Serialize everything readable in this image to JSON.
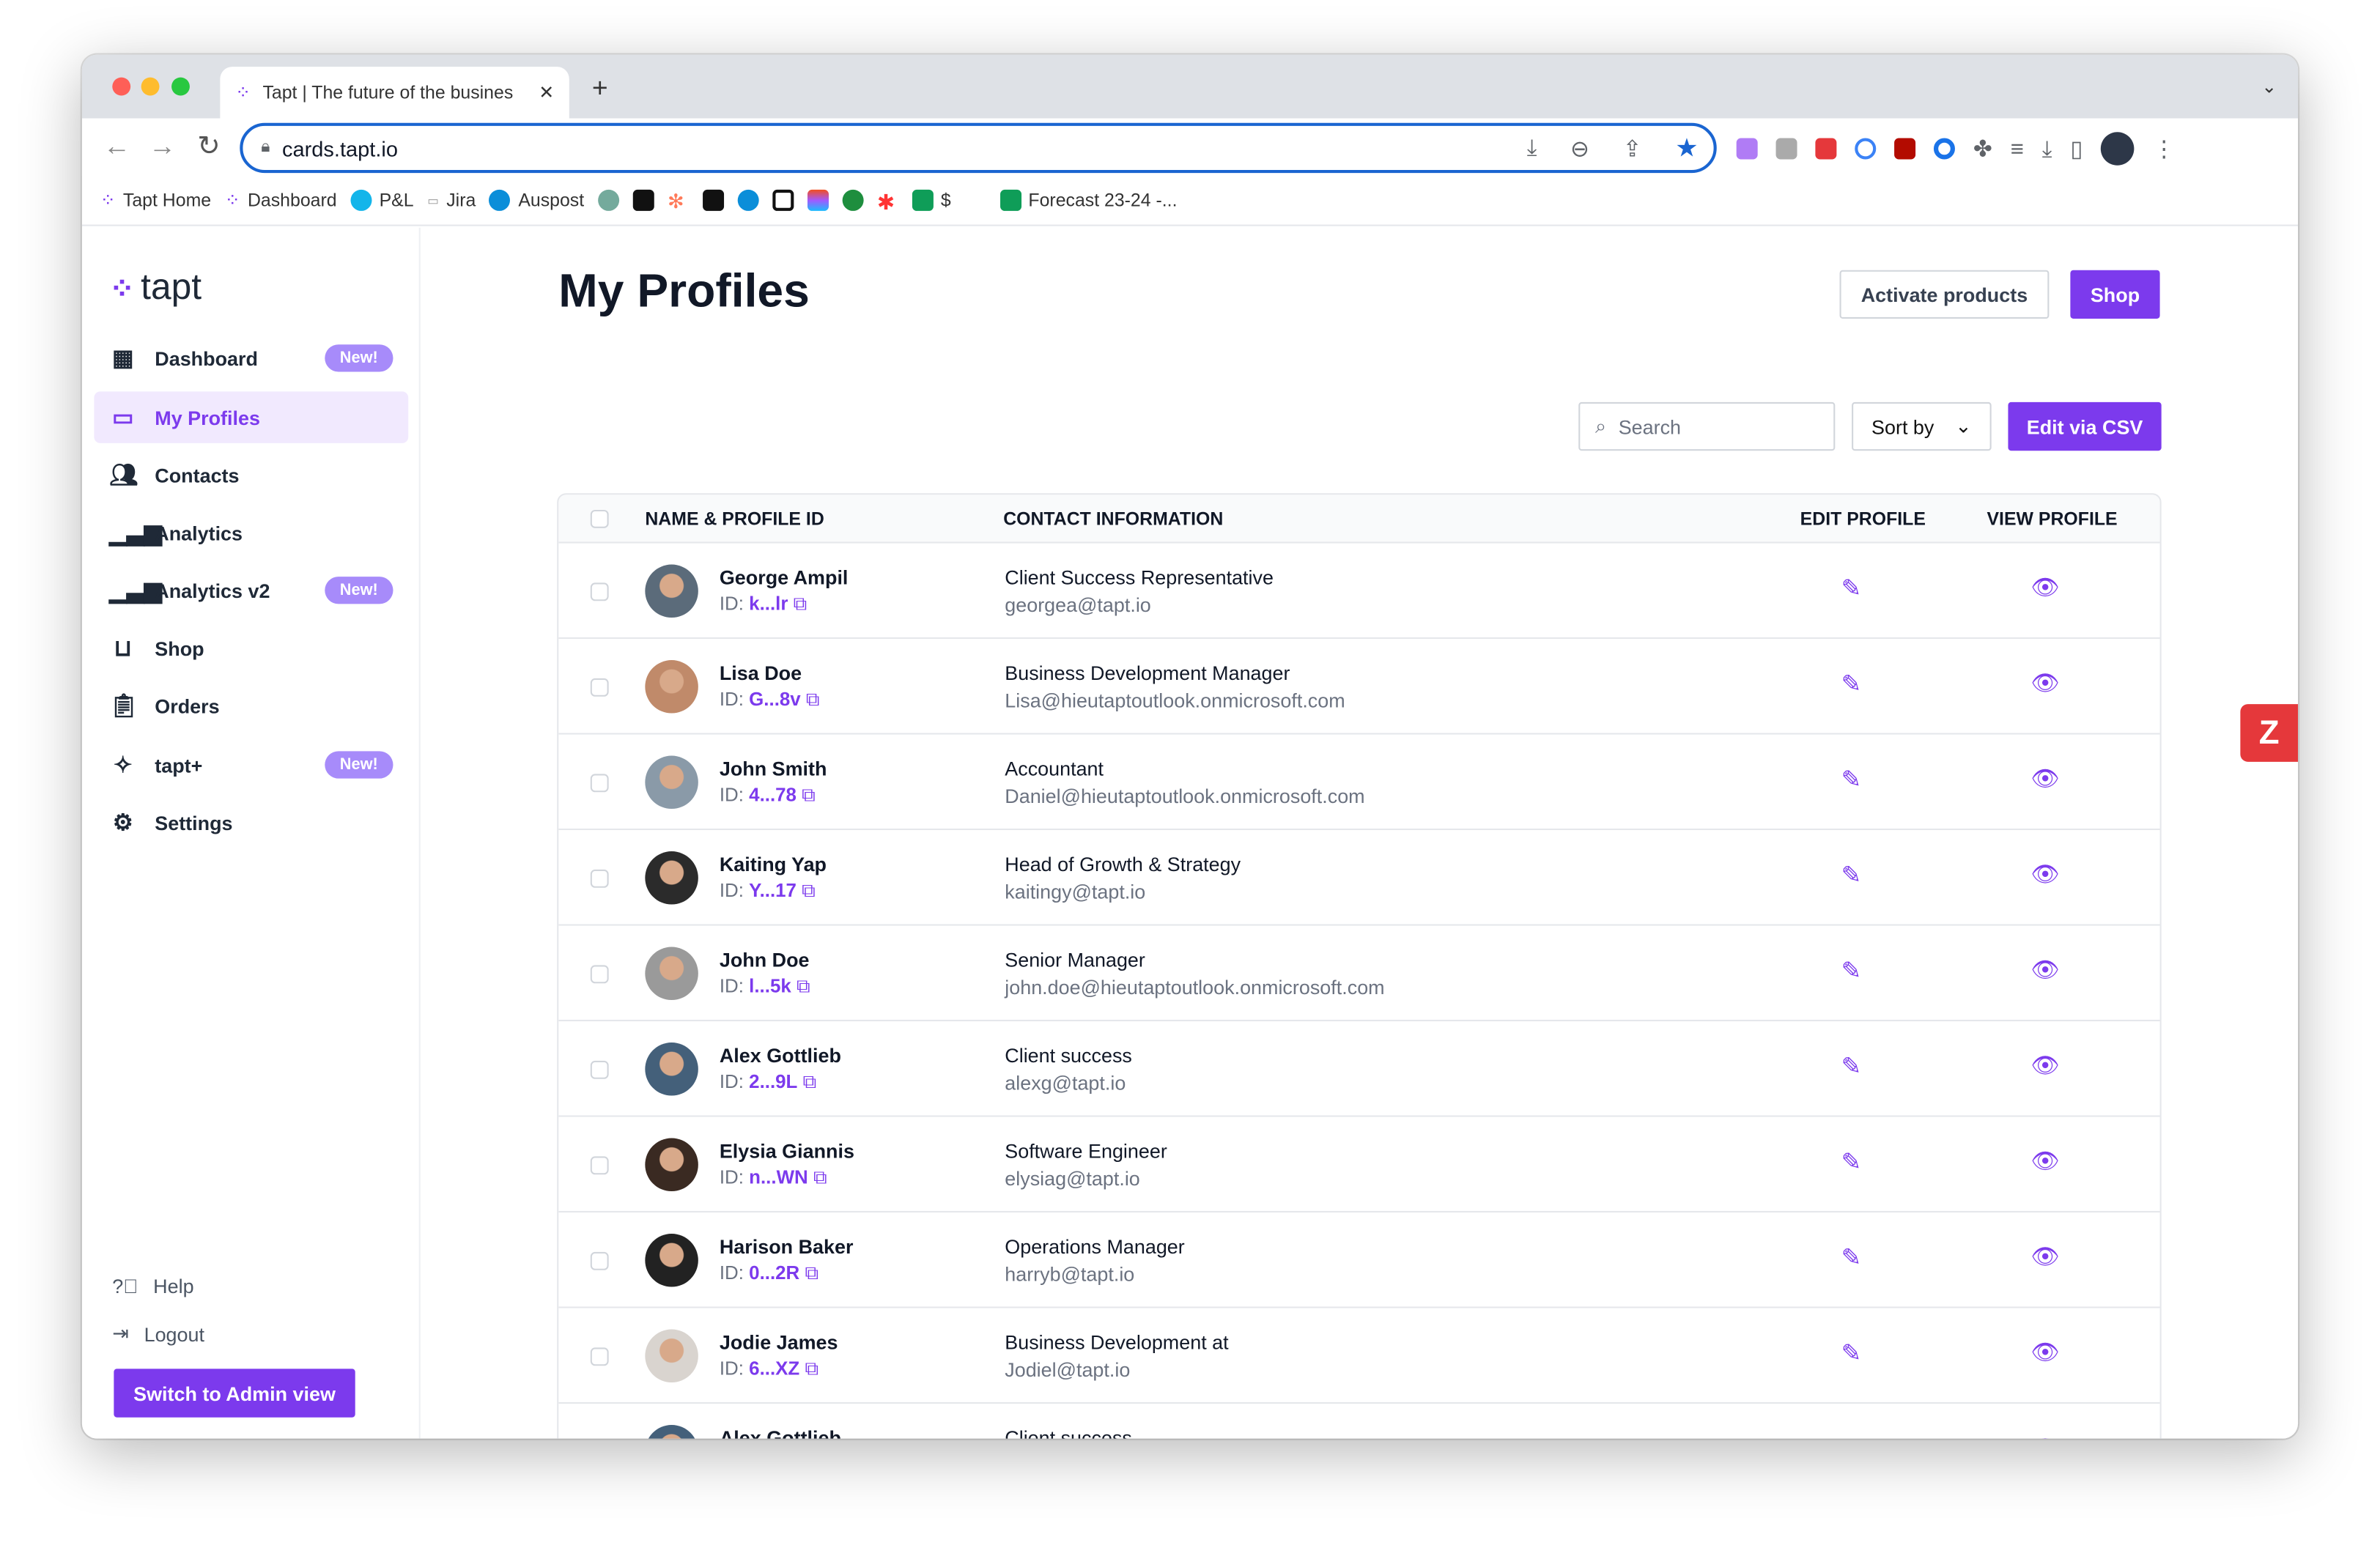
{
  "browser": {
    "tab_title": "Tapt | The future of the busines",
    "url": "cards.tapt.io",
    "bookmarks": [
      "Tapt Home",
      "Dashboard",
      "P&L",
      "Jira",
      "Auspost",
      "$",
      "Forecast 23-24 -..."
    ],
    "accent": "#1a65d1"
  },
  "sidebar": {
    "logo": "tapt",
    "items": [
      {
        "label": "Dashboard",
        "badge": "New!",
        "icon": "dashboard-icon"
      },
      {
        "label": "My Profiles",
        "icon": "profile-card-icon"
      },
      {
        "label": "Contacts",
        "icon": "users-icon"
      },
      {
        "label": "Analytics",
        "icon": "bar-chart-icon"
      },
      {
        "label": "Analytics v2",
        "badge": "New!",
        "icon": "bar-chart-icon"
      },
      {
        "label": "Shop",
        "icon": "shop-icon"
      },
      {
        "label": "Orders",
        "icon": "clipboard-icon"
      },
      {
        "label": "tapt+",
        "badge": "New!",
        "icon": "sparkles-icon"
      },
      {
        "label": "Settings",
        "icon": "gear-icon"
      }
    ],
    "help": "Help",
    "logout": "Logout",
    "admin_button": "Switch to Admin view"
  },
  "main": {
    "title": "My Profiles",
    "activate": "Activate products",
    "shop": "Shop",
    "search_placeholder": "Search",
    "sort": "Sort by",
    "edit_csv": "Edit via CSV",
    "brand": "#7c3aed",
    "columns": [
      "NAME & PROFILE ID",
      "CONTACT INFORMATION",
      "EDIT PROFILE",
      "VIEW PROFILE"
    ],
    "id_prefix": "ID:",
    "rows": [
      {
        "name": "George Ampil",
        "id": "k...lr",
        "role": "Client Success Representative",
        "email": "georgea@tapt.io"
      },
      {
        "name": "Lisa Doe",
        "id": "G...8v",
        "role": "Business Development Manager",
        "email": "Lisa@hieutaptoutlook.onmicrosoft.com"
      },
      {
        "name": "John Smith",
        "id": "4...78",
        "role": "Accountant",
        "email": "Daniel@hieutaptoutlook.onmicrosoft.com"
      },
      {
        "name": "Kaiting Yap",
        "id": "Y...17",
        "role": "Head of Growth & Strategy",
        "email": "kaitingy@tapt.io"
      },
      {
        "name": "John Doe",
        "id": "l...5k",
        "role": "Senior Manager",
        "email": "john.doe@hieutaptoutlook.onmicrosoft.com"
      },
      {
        "name": "Alex Gottlieb",
        "id": "2...9L",
        "role": "Client success",
        "email": "alexg@tapt.io"
      },
      {
        "name": "Elysia Giannis",
        "id": "n...WN",
        "role": "Software Engineer",
        "email": "elysiag@tapt.io"
      },
      {
        "name": "Harison Baker",
        "id": "0...2R",
        "role": "Operations Manager",
        "email": "harryb@tapt.io"
      },
      {
        "name": "Jodie James",
        "id": "6...XZ",
        "role": "Business Development at",
        "email": "Jodiel@tapt.io"
      },
      {
        "name": "Alex Gottlieb",
        "id": "",
        "role": "Client success",
        "email": ""
      }
    ]
  }
}
